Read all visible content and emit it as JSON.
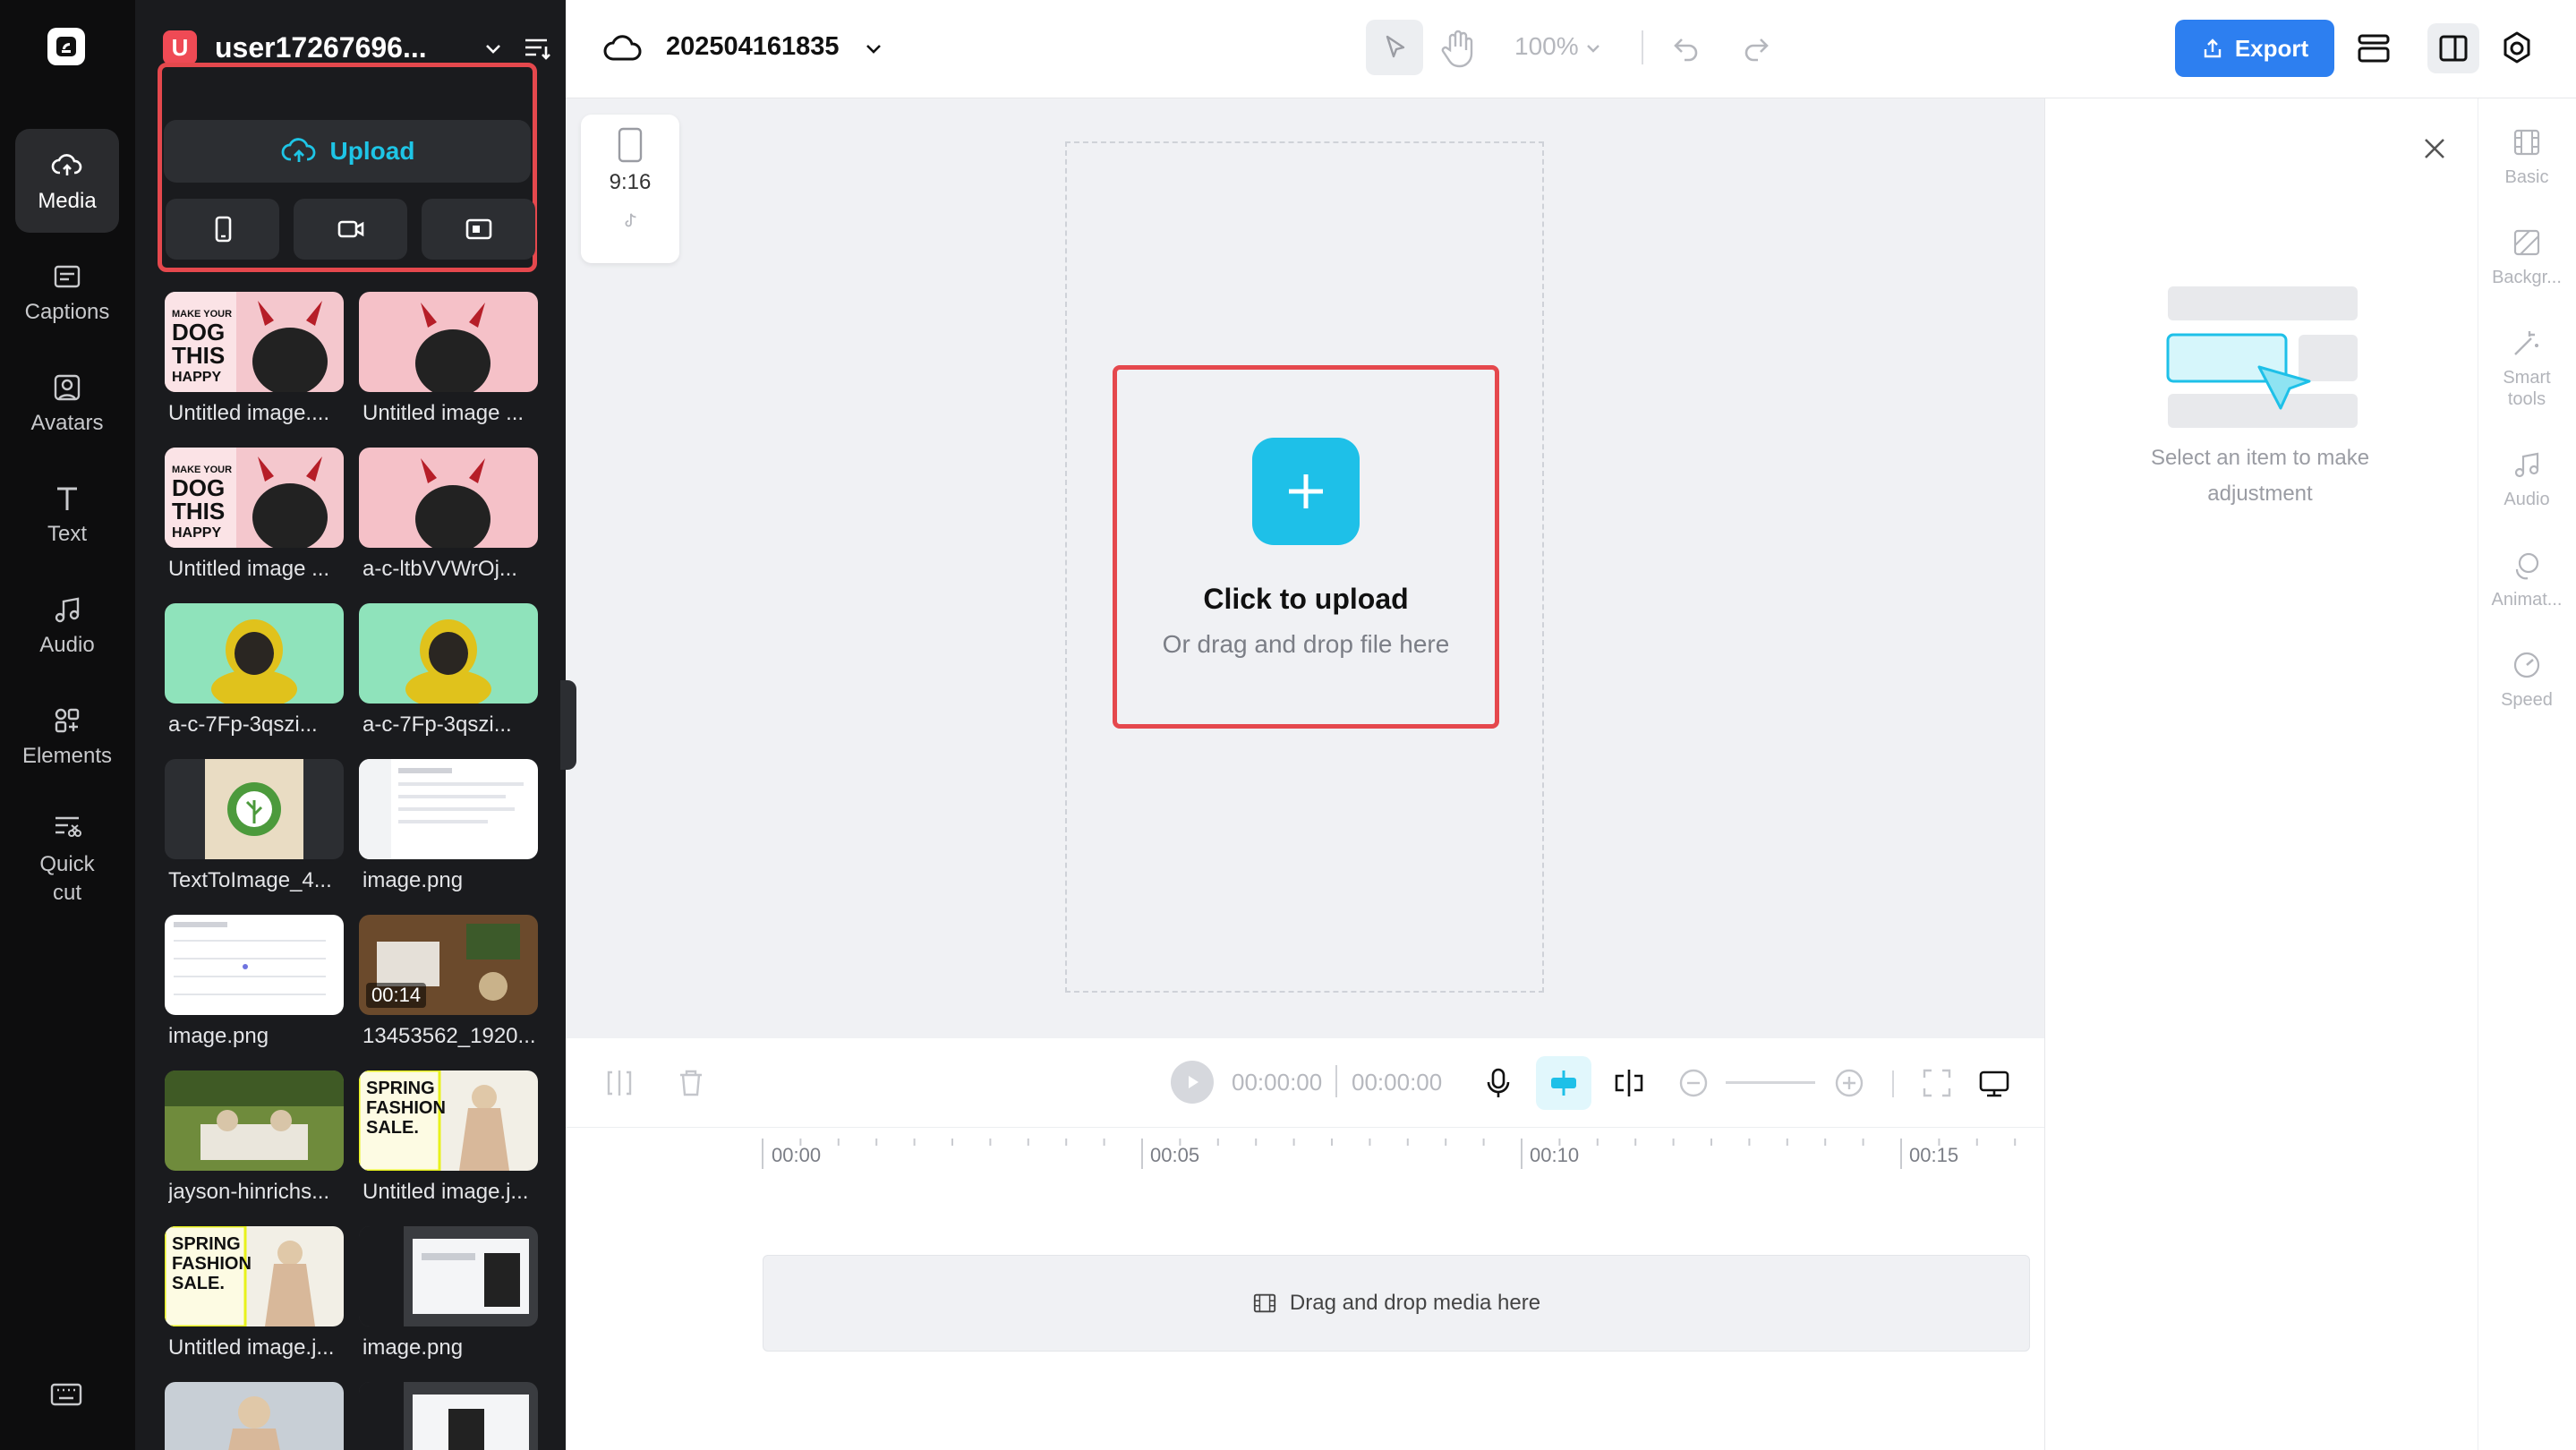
{
  "window": {
    "title": "202504161835"
  },
  "rail": {
    "items": [
      {
        "label": "Media",
        "icon": "cloud-upload-icon"
      },
      {
        "label": "Captions",
        "icon": "captions-icon"
      },
      {
        "label": "Avatars",
        "icon": "avatar-icon"
      },
      {
        "label": "Text",
        "icon": "text-icon"
      },
      {
        "label": "Audio",
        "icon": "music-note-icon"
      },
      {
        "label": "Elements",
        "icon": "elements-icon"
      },
      {
        "label": "Quick",
        "label2": "cut",
        "icon": "quick-cut-icon"
      }
    ]
  },
  "panel": {
    "user_initial": "U",
    "user_name": "user17267696...",
    "upload_label": "Upload",
    "media": [
      {
        "label": "Untitled image....",
        "kind": "dog-meme"
      },
      {
        "label": "Untitled image ...",
        "kind": "dog-pink"
      },
      {
        "label": "Untitled image ...",
        "kind": "dog-meme"
      },
      {
        "label": "a-c-ltbVVWrOj...",
        "kind": "dog-pink"
      },
      {
        "label": "a-c-7Fp-3qszi...",
        "kind": "pug-green"
      },
      {
        "label": "a-c-7Fp-3qszi...",
        "kind": "pug-green"
      },
      {
        "label": "TextToImage_4...",
        "kind": "logo-leaf"
      },
      {
        "label": "image.png",
        "kind": "screenshot"
      },
      {
        "label": "image.png",
        "kind": "calendar"
      },
      {
        "label": "13453562_1920...",
        "kind": "desk",
        "duration": "00:14"
      },
      {
        "label": "jayson-hinrichs...",
        "kind": "picnic"
      },
      {
        "label": "Untitled image.j...",
        "kind": "fashion"
      },
      {
        "label": "Untitled image.j...",
        "kind": "fashion"
      },
      {
        "label": "image.png",
        "kind": "editor"
      },
      {
        "label": "",
        "kind": "person"
      },
      {
        "label": "",
        "kind": "editor2"
      }
    ]
  },
  "topbar": {
    "project_name": "202504161835",
    "zoom": "100%",
    "export_label": "Export"
  },
  "canvas": {
    "ratio_label": "9:16",
    "drop_title": "Click to upload",
    "drop_sub": "Or drag and drop file here"
  },
  "properties": {
    "message_line1": "Select an item to make",
    "message_line2": "adjustment",
    "tabs": [
      {
        "label": "Basic"
      },
      {
        "label": "Backgr..."
      },
      {
        "label": "Smart",
        "label2": "tools"
      },
      {
        "label": "Audio"
      },
      {
        "label": "Animat..."
      },
      {
        "label": "Speed"
      }
    ]
  },
  "timeline": {
    "time_current": "00:00:00",
    "time_total": "00:00:00",
    "ticks": [
      "00:00",
      "00:05",
      "00:10",
      "00:15"
    ],
    "drop_hint": "Drag and drop media here"
  },
  "colors": {
    "accent": "#1ec0e8",
    "export": "#2d7ff0",
    "highlight": "#e5484d"
  }
}
